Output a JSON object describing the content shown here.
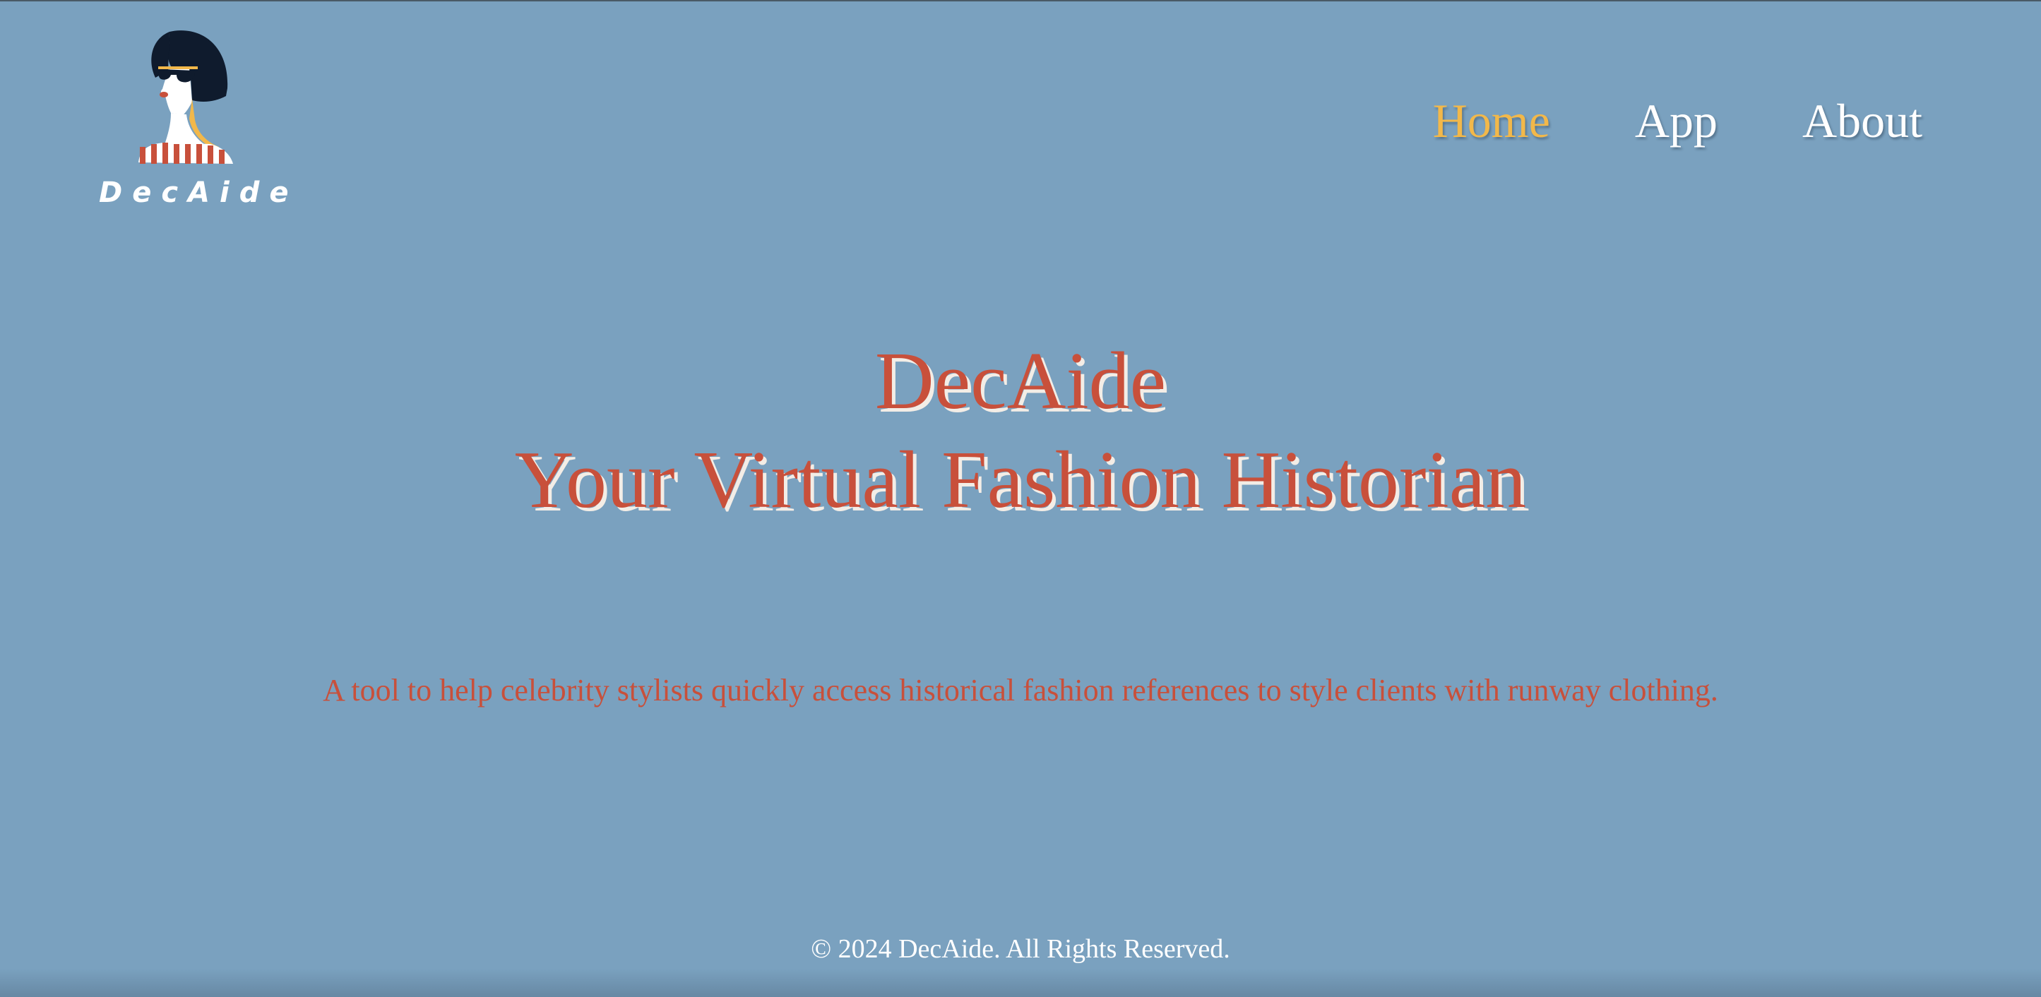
{
  "brand": {
    "logo_text": "DecAide",
    "logo_icon": "woman-with-sunglasses-icon"
  },
  "nav": {
    "items": [
      {
        "label": "Home",
        "active": true
      },
      {
        "label": "App",
        "active": false
      },
      {
        "label": "About",
        "active": false
      }
    ]
  },
  "hero": {
    "title": "DecAide",
    "subtitle": "Your Virtual Fashion Historian"
  },
  "tagline": "A tool to help celebrity stylists quickly access historical fashion references to style clients with runway clothing.",
  "footer": {
    "copyright": "© 2024 DecAide. All Rights Reserved."
  },
  "colors": {
    "background": "#7aa1bf",
    "accent_red": "#c8503b",
    "nav_active": "#f2b84a",
    "text_white": "#ffffff"
  }
}
